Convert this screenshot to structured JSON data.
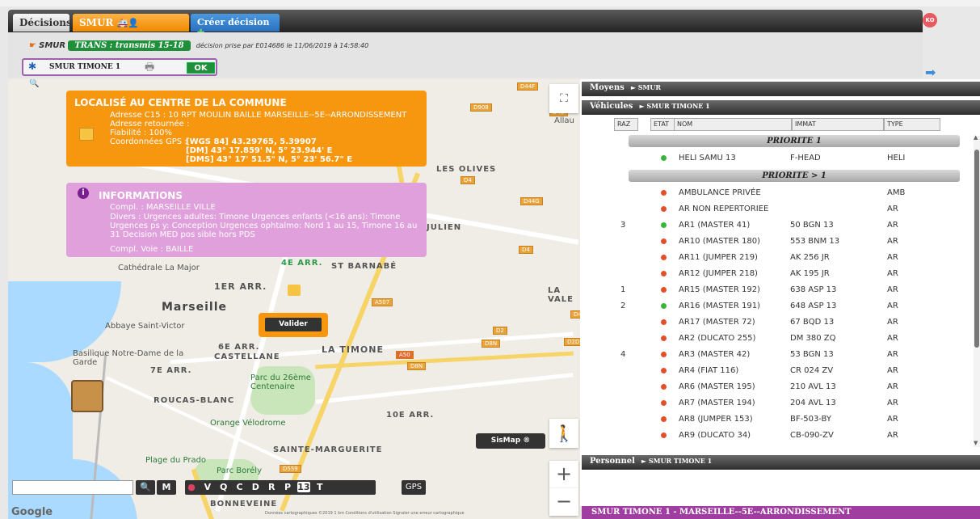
{
  "tabs": {
    "decisions": "Décisions",
    "smur": "SMUR",
    "create": "Créer décision",
    "ko": "KO"
  },
  "decision": {
    "smur_label": "SMUR",
    "badge": "TRANS : transmis 15-18",
    "info": "décision prise par E014686  le 11/06/2019 à 14:58:40"
  },
  "unit": {
    "name": "SMUR TIMONE 1",
    "ok": "OK"
  },
  "map": {
    "labels": [
      "LES OLIVES",
      "JULIEN",
      "4E ARR.",
      "ST BARNABÉ",
      "1ER ARR.",
      "LA VALE",
      "Marseille",
      "Abbaye Saint-Victor",
      "Basilique Notre-Dame de la Garde",
      "6E ARR.",
      "7E ARR.",
      "CASTELLANE",
      "LA TIMONE",
      "Parc du 26ème Centenaire",
      "ROUCAS-BLANC",
      "10E ARR.",
      "Orange Vélodrome",
      "SAINTE-MARGUERITE",
      "Plage du Prado",
      "Parc Borély",
      "BONNEVEINE",
      "Cathédrale La Major",
      "Allau",
      "Google"
    ],
    "shields": [
      "D44F",
      "D908",
      "D4B",
      "D4",
      "D44G",
      "D4",
      "A507",
      "D2",
      "D8N",
      "D2D",
      "A50",
      "D8N",
      "D559",
      "D4"
    ],
    "footer": "Données cartographiques ©2019   1 km     Conditions d'utilisation   Signaler une erreur cartographique"
  },
  "info_localise": {
    "title": "LOCALISÉ AU CENTRE DE LA COMMUNE",
    "adresse": "Adresse C15 : 10 RPT MOULIN BAILLE MARSEILLE--5E--ARRONDISSEMENT",
    "retournee": "Adresse retournée :",
    "fiabilite": "Fiabilité : 100%",
    "gps_label": "Coordonnées GPS :",
    "wgs": "[WGS 84] 43.29765, 5.39907",
    "dm": "[DM] 43° 17.859' N, 5° 23.944' E",
    "dms": "[DMS] 43° 17' 51.5\" N, 5° 23' 56.7\" E"
  },
  "info_informations": {
    "title": "INFORMATIONS",
    "compl": "Compl. : MARSEILLE VILLE",
    "divers": "Divers : Urgences adultes: Timone Urgences enfants (<16 ans): Timone Urgences ps y: Conception Urgences ophtalmo: Nord 1 au 15, Timone 16 au 31 Decision MED pos sible hors PDS",
    "voie": "Compl. Voie : BAILLE"
  },
  "buttons": {
    "valider": "Valider",
    "sismap": "SisMap ®",
    "gps": "GPS",
    "m": "M",
    "search_icon": "🔍"
  },
  "filters": [
    "V",
    "Q",
    "C",
    "D",
    "R",
    "P",
    "13",
    "T"
  ],
  "panel": {
    "moyens": "Moyens",
    "moyens_sub": "► SMUR",
    "vehicules": "Véhicules",
    "vehicules_sub": "► SMUR TIMONE 1",
    "personnel": "Personnel",
    "personnel_sub": "► SMUR TIMONE 1",
    "footer": "SMUR TIMONE 1 - MARSEILLE--5E--ARRONDISSEMENT"
  },
  "table_headers": {
    "raz": "RAZ",
    "etat": "ETAT",
    "nom": "NOM",
    "immat": "IMMAT",
    "type": "TYPE"
  },
  "priorite1": "PRIORITE 1",
  "priorite2": "PRIORITE > 1",
  "colors": {
    "green": "#3ab33a",
    "red": "#e0502a"
  },
  "vehicles_p1": [
    {
      "raz": "",
      "status": "green",
      "nom": "HELI SAMU 13",
      "immat": "F-HEAD",
      "type": "HELI"
    }
  ],
  "vehicles_p2": [
    {
      "raz": "",
      "status": "red",
      "nom": "AMBULANCE PRIVÉE",
      "immat": "",
      "type": "AMB"
    },
    {
      "raz": "",
      "status": "red",
      "nom": "AR NON REPERTORIEE",
      "immat": "",
      "type": "AR"
    },
    {
      "raz": "3",
      "status": "green",
      "nom": "AR1 (MASTER 41)",
      "immat": "50 BGN 13",
      "type": "AR"
    },
    {
      "raz": "",
      "status": "red",
      "nom": "AR10 (MASTER 180)",
      "immat": "553 BNM 13",
      "type": "AR"
    },
    {
      "raz": "",
      "status": "red",
      "nom": "AR11 (JUMPER 219)",
      "immat": "AK 256 JR",
      "type": "AR"
    },
    {
      "raz": "",
      "status": "red",
      "nom": "AR12 (JUMPER 218)",
      "immat": "AK 195 JR",
      "type": "AR"
    },
    {
      "raz": "1",
      "status": "red",
      "nom": "AR15 (MASTER 192)",
      "immat": "638 ASP 13",
      "type": "AR"
    },
    {
      "raz": "2",
      "status": "green",
      "nom": "AR16 (MASTER 191)",
      "immat": "648 ASP 13",
      "type": "AR"
    },
    {
      "raz": "",
      "status": "red",
      "nom": "AR17 (MASTER 72)",
      "immat": "67 BQD 13",
      "type": "AR"
    },
    {
      "raz": "",
      "status": "red",
      "nom": "AR2 (DUCATO 255)",
      "immat": "DM 380 ZQ",
      "type": "AR"
    },
    {
      "raz": "4",
      "status": "red",
      "nom": "AR3 (MASTER 42)",
      "immat": "53 BGN 13",
      "type": "AR"
    },
    {
      "raz": "",
      "status": "red",
      "nom": "AR4 (FIAT 116)",
      "immat": "CR 024 ZV",
      "type": "AR"
    },
    {
      "raz": "",
      "status": "red",
      "nom": "AR6 (MASTER 195)",
      "immat": "210 AVL 13",
      "type": "AR"
    },
    {
      "raz": "",
      "status": "red",
      "nom": "AR7 (MASTER 194)",
      "immat": "204 AVL 13",
      "type": "AR"
    },
    {
      "raz": "",
      "status": "red",
      "nom": "AR8 (JUMPER 153)",
      "immat": "BF-503-BY",
      "type": "AR"
    },
    {
      "raz": "",
      "status": "red",
      "nom": "AR9 (DUCATO 34)",
      "immat": "CB-090-ZV",
      "type": "AR"
    }
  ]
}
